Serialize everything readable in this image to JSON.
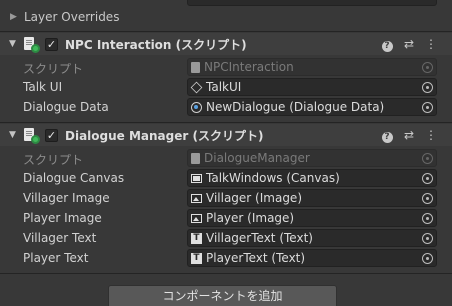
{
  "layer_overrides": {
    "label": "Layer Overrides"
  },
  "components": [
    {
      "title": "NPC Interaction (スクリプト)",
      "enabled": true,
      "props": [
        {
          "label": "スクリプト",
          "value": "NPCInteraction",
          "icon": "script-icon",
          "disabled": true
        },
        {
          "label": "Talk UI",
          "value": "TalkUI",
          "icon": "gameobject-icon",
          "disabled": false
        },
        {
          "label": "Dialogue Data",
          "value": "NewDialogue (Dialogue Data)",
          "icon": "scriptable-asset-icon",
          "disabled": false
        }
      ]
    },
    {
      "title": "Dialogue Manager (スクリプト)",
      "enabled": true,
      "props": [
        {
          "label": "スクリプト",
          "value": "DialogueManager",
          "icon": "script-icon",
          "disabled": true
        },
        {
          "label": "Dialogue Canvas",
          "value": "TalkWindows (Canvas)",
          "icon": "canvas-icon",
          "disabled": false
        },
        {
          "label": "Villager Image",
          "value": "Villager (Image)",
          "icon": "image-icon",
          "disabled": false
        },
        {
          "label": "Player Image",
          "value": "Player (Image)",
          "icon": "image-icon",
          "disabled": false
        },
        {
          "label": "Villager Text",
          "value": "VillagerText (Text)",
          "icon": "text-icon",
          "disabled": false
        },
        {
          "label": "Player Text",
          "value": "PlayerText (Text)",
          "icon": "text-icon",
          "disabled": false
        }
      ]
    }
  ],
  "header_icons": [
    "help-icon",
    "preset-icon",
    "kebab-menu-icon"
  ],
  "add_component_label": "コンポーネントを追加"
}
